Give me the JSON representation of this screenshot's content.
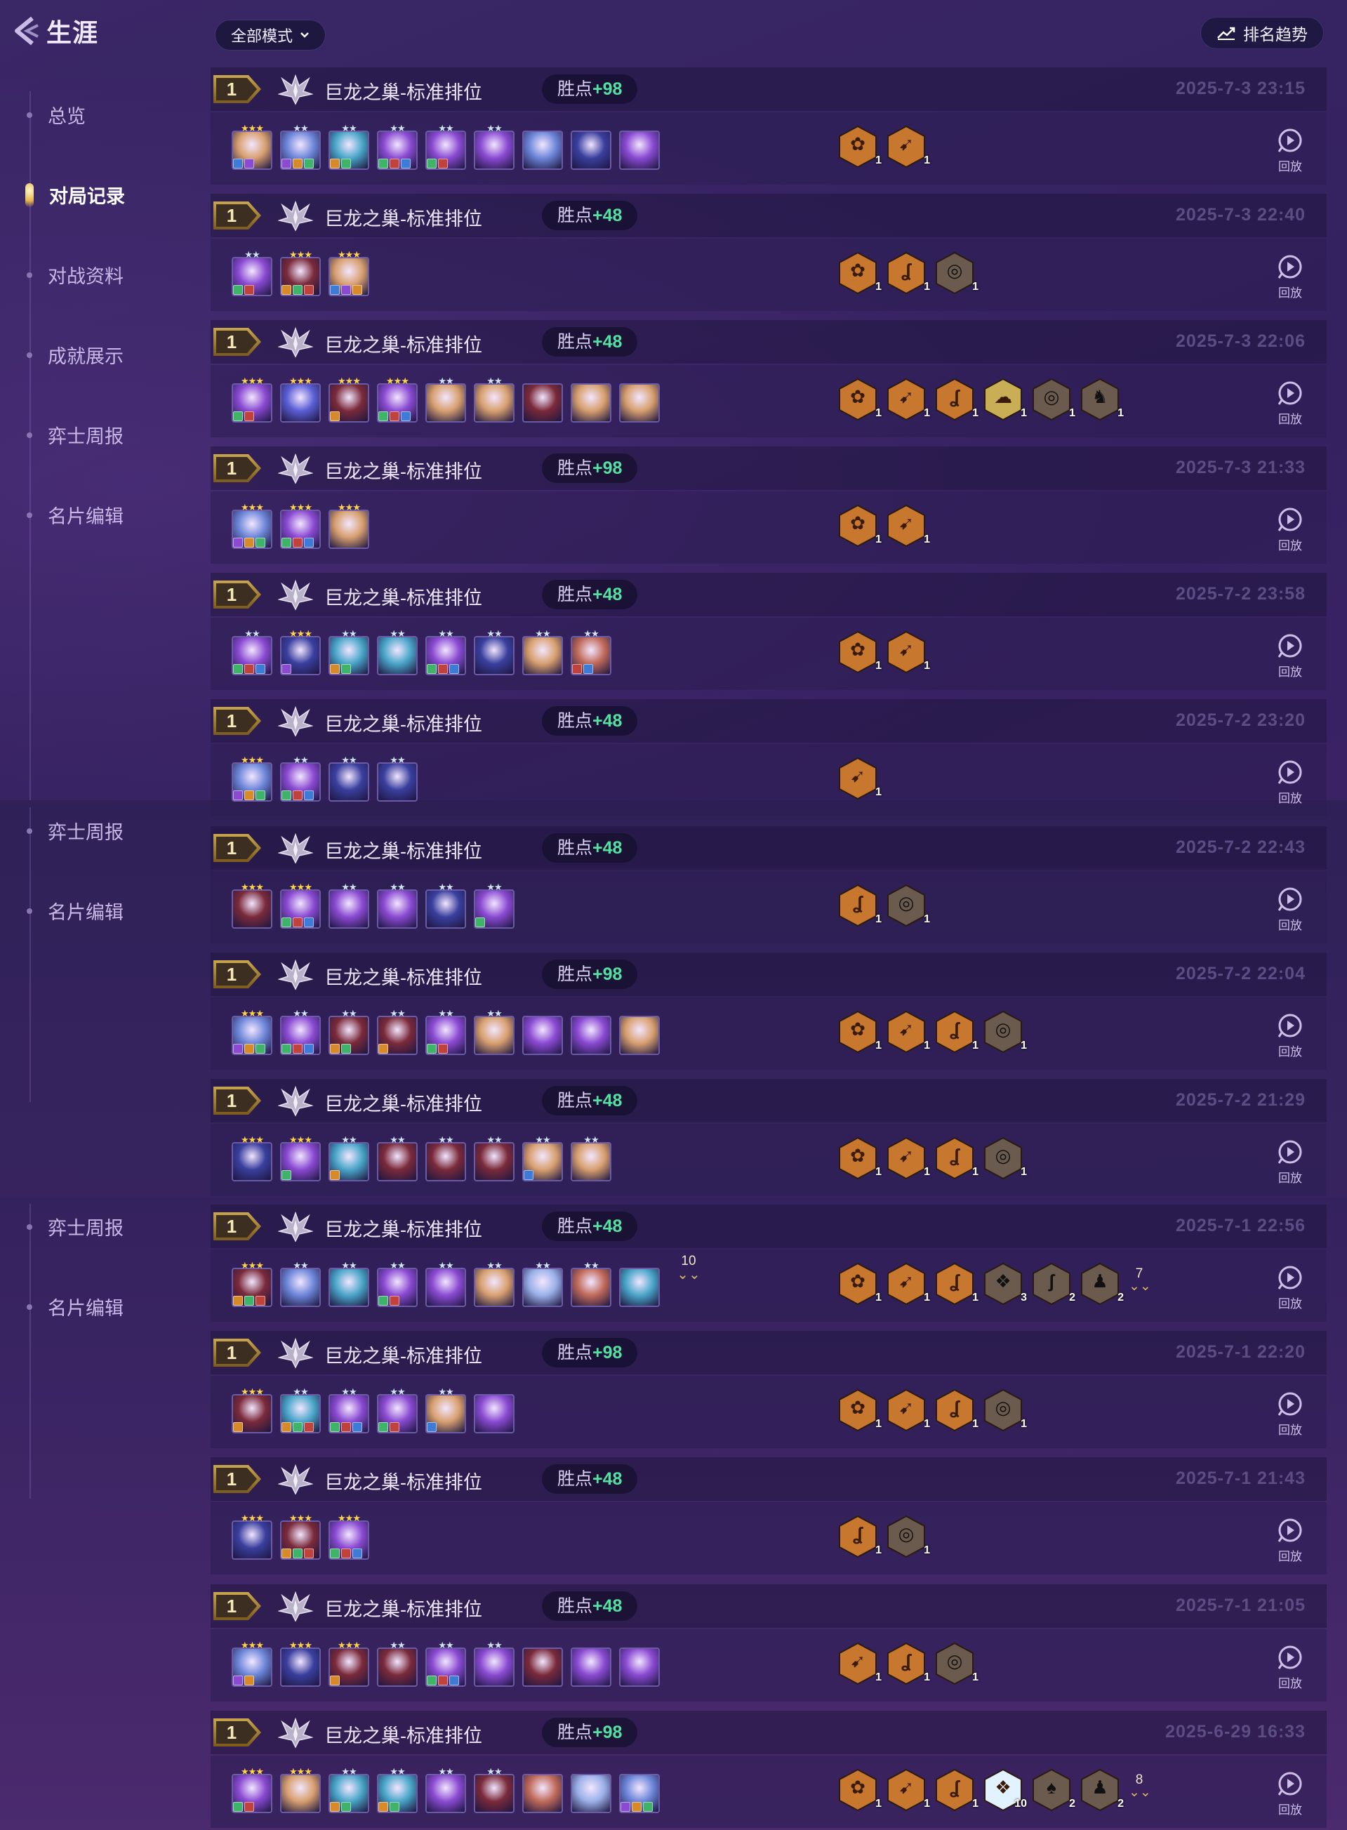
{
  "header": {
    "title": "生涯",
    "mode_label": "全部模式",
    "trend_label": "排名趋势"
  },
  "nav": {
    "items": [
      {
        "label": "总览",
        "active": false
      },
      {
        "label": "对局记录",
        "active": true
      },
      {
        "label": "对战资料",
        "active": false
      },
      {
        "label": "成就展示",
        "active": false
      },
      {
        "label": "弈士周报",
        "active": false
      },
      {
        "label": "名片编辑",
        "active": false
      }
    ],
    "repeat": [
      {
        "label": "弈士周报"
      },
      {
        "label": "名片编辑"
      },
      {
        "label": "弈士周报"
      },
      {
        "label": "名片编辑"
      }
    ]
  },
  "replay_label": "回放",
  "lp_prefix": "胜点",
  "colors": {
    "portrait_palette": [
      "#5b5fd6",
      "#6d86d9",
      "#4aa6c9",
      "#8a4ad2",
      "#c06a5a",
      "#d8a070",
      "#3a3f9e",
      "#7a2a3a",
      "#9ab0e8"
    ],
    "trait_bronze": "#c8782e",
    "trait_gold": "#c9ae55",
    "trait_gray": "#6b5a4e",
    "trait_prismatic": "#e3f2ff"
  },
  "matches": [
    {
      "rank": "1",
      "mode": "巨龙之巢-标准排位",
      "lp": "+98",
      "time": "2025-7-3 23:15",
      "units": [
        {
          "stars": 3,
          "c": 5,
          "items": 2
        },
        {
          "stars": 2,
          "c": 1,
          "items": 3
        },
        {
          "stars": 2,
          "c": 2,
          "items": 2
        },
        {
          "stars": 2,
          "c": 3,
          "items": 3
        },
        {
          "stars": 2,
          "c": 3,
          "items": 2
        },
        {
          "stars": 2,
          "c": 3,
          "items": 0
        },
        {
          "stars": 0,
          "c": 1,
          "items": 0
        },
        {
          "stars": 0,
          "c": 6,
          "items": 0
        },
        {
          "stars": 0,
          "c": 3,
          "items": 0
        }
      ],
      "more": "",
      "traits": [
        {
          "g": "✿",
          "n": "1",
          "t": "bronze"
        },
        {
          "g": "➹",
          "n": "1",
          "t": "bronze"
        }
      ],
      "traits_more": ""
    },
    {
      "rank": "1",
      "mode": "巨龙之巢-标准排位",
      "lp": "+48",
      "time": "2025-7-3 22:40",
      "units": [
        {
          "stars": 2,
          "c": 3,
          "items": 2
        },
        {
          "stars": 3,
          "c": 7,
          "items": 3
        },
        {
          "stars": 3,
          "c": 5,
          "items": 3
        }
      ],
      "more": "",
      "traits": [
        {
          "g": "✿",
          "n": "1",
          "t": "bronze"
        },
        {
          "g": "ʆ",
          "n": "1",
          "t": "bronze"
        },
        {
          "g": "◎",
          "n": "1",
          "t": "gray"
        }
      ],
      "traits_more": ""
    },
    {
      "rank": "1",
      "mode": "巨龙之巢-标准排位",
      "lp": "+48",
      "time": "2025-7-3 22:06",
      "units": [
        {
          "stars": 3,
          "c": 3,
          "items": 2
        },
        {
          "stars": 3,
          "c": 0,
          "items": 0
        },
        {
          "stars": 3,
          "c": 7,
          "items": 1
        },
        {
          "stars": 3,
          "c": 3,
          "items": 3
        },
        {
          "stars": 2,
          "c": 5,
          "items": 0
        },
        {
          "stars": 2,
          "c": 5,
          "items": 0
        },
        {
          "stars": 0,
          "c": 7,
          "items": 0
        },
        {
          "stars": 0,
          "c": 5,
          "items": 0
        },
        {
          "stars": 0,
          "c": 5,
          "items": 0
        }
      ],
      "more": "",
      "traits": [
        {
          "g": "✿",
          "n": "1",
          "t": "bronze"
        },
        {
          "g": "➹",
          "n": "1",
          "t": "bronze"
        },
        {
          "g": "ʆ",
          "n": "1",
          "t": "bronze"
        },
        {
          "g": "☁",
          "n": "1",
          "t": "gold"
        },
        {
          "g": "◎",
          "n": "1",
          "t": "gray"
        },
        {
          "g": "♞",
          "n": "1",
          "t": "gray"
        }
      ],
      "traits_more": ""
    },
    {
      "rank": "1",
      "mode": "巨龙之巢-标准排位",
      "lp": "+98",
      "time": "2025-7-3 21:33",
      "units": [
        {
          "stars": 3,
          "c": 1,
          "items": 3
        },
        {
          "stars": 3,
          "c": 3,
          "items": 3
        },
        {
          "stars": 3,
          "c": 5,
          "items": 0
        }
      ],
      "more": "",
      "traits": [
        {
          "g": "✿",
          "n": "1",
          "t": "bronze"
        },
        {
          "g": "➹",
          "n": "1",
          "t": "bronze"
        }
      ],
      "traits_more": ""
    },
    {
      "rank": "1",
      "mode": "巨龙之巢-标准排位",
      "lp": "+48",
      "time": "2025-7-2 23:58",
      "units": [
        {
          "stars": 2,
          "c": 3,
          "items": 3
        },
        {
          "stars": 3,
          "c": 6,
          "items": 1
        },
        {
          "stars": 2,
          "c": 2,
          "items": 2
        },
        {
          "stars": 2,
          "c": 2,
          "items": 0
        },
        {
          "stars": 2,
          "c": 3,
          "items": 3
        },
        {
          "stars": 2,
          "c": 6,
          "items": 0
        },
        {
          "stars": 2,
          "c": 5,
          "items": 0
        },
        {
          "stars": 2,
          "c": 4,
          "items": 2
        }
      ],
      "more": "",
      "traits": [
        {
          "g": "✿",
          "n": "1",
          "t": "bronze"
        },
        {
          "g": "➹",
          "n": "1",
          "t": "bronze"
        }
      ],
      "traits_more": ""
    },
    {
      "rank": "1",
      "mode": "巨龙之巢-标准排位",
      "lp": "+48",
      "time": "2025-7-2 23:20",
      "units": [
        {
          "stars": 3,
          "c": 1,
          "items": 3
        },
        {
          "stars": 2,
          "c": 3,
          "items": 3
        },
        {
          "stars": 2,
          "c": 6,
          "items": 0
        },
        {
          "stars": 2,
          "c": 6,
          "items": 0
        }
      ],
      "more": "",
      "traits": [
        {
          "g": "➹",
          "n": "1",
          "t": "bronze"
        }
      ],
      "traits_more": ""
    },
    {
      "rank": "1",
      "mode": "巨龙之巢-标准排位",
      "lp": "+48",
      "time": "2025-7-2 22:43",
      "units": [
        {
          "stars": 3,
          "c": 7,
          "items": 0
        },
        {
          "stars": 3,
          "c": 3,
          "items": 3
        },
        {
          "stars": 2,
          "c": 3,
          "items": 0
        },
        {
          "stars": 2,
          "c": 3,
          "items": 0
        },
        {
          "stars": 2,
          "c": 6,
          "items": 0
        },
        {
          "stars": 2,
          "c": 3,
          "items": 1
        }
      ],
      "more": "",
      "traits": [
        {
          "g": "ʆ",
          "n": "1",
          "t": "bronze"
        },
        {
          "g": "◎",
          "n": "1",
          "t": "gray"
        }
      ],
      "traits_more": ""
    },
    {
      "rank": "1",
      "mode": "巨龙之巢-标准排位",
      "lp": "+98",
      "time": "2025-7-2 22:04",
      "units": [
        {
          "stars": 3,
          "c": 1,
          "items": 3
        },
        {
          "stars": 2,
          "c": 3,
          "items": 3
        },
        {
          "stars": 2,
          "c": 7,
          "items": 2
        },
        {
          "stars": 2,
          "c": 7,
          "items": 1
        },
        {
          "stars": 2,
          "c": 3,
          "items": 2
        },
        {
          "stars": 2,
          "c": 5,
          "items": 0
        },
        {
          "stars": 0,
          "c": 3,
          "items": 0
        },
        {
          "stars": 0,
          "c": 3,
          "items": 0
        },
        {
          "stars": 0,
          "c": 5,
          "items": 0
        }
      ],
      "more": "",
      "traits": [
        {
          "g": "✿",
          "n": "1",
          "t": "bronze"
        },
        {
          "g": "➹",
          "n": "1",
          "t": "bronze"
        },
        {
          "g": "ʆ",
          "n": "1",
          "t": "bronze"
        },
        {
          "g": "◎",
          "n": "1",
          "t": "gray"
        }
      ],
      "traits_more": ""
    },
    {
      "rank": "1",
      "mode": "巨龙之巢-标准排位",
      "lp": "+48",
      "time": "2025-7-2 21:29",
      "units": [
        {
          "stars": 3,
          "c": 6,
          "items": 0
        },
        {
          "stars": 3,
          "c": 3,
          "items": 1
        },
        {
          "stars": 2,
          "c": 2,
          "items": 1
        },
        {
          "stars": 2,
          "c": 7,
          "items": 0
        },
        {
          "stars": 2,
          "c": 7,
          "items": 0
        },
        {
          "stars": 2,
          "c": 7,
          "items": 0
        },
        {
          "stars": 2,
          "c": 5,
          "items": 1
        },
        {
          "stars": 2,
          "c": 5,
          "items": 0
        }
      ],
      "more": "",
      "traits": [
        {
          "g": "✿",
          "n": "1",
          "t": "bronze"
        },
        {
          "g": "➹",
          "n": "1",
          "t": "bronze"
        },
        {
          "g": "ʆ",
          "n": "1",
          "t": "bronze"
        },
        {
          "g": "◎",
          "n": "1",
          "t": "gray"
        }
      ],
      "traits_more": ""
    },
    {
      "rank": "1",
      "mode": "巨龙之巢-标准排位",
      "lp": "+48",
      "time": "2025-7-1 22:56",
      "units": [
        {
          "stars": 3,
          "c": 7,
          "items": 3
        },
        {
          "stars": 2,
          "c": 1,
          "items": 0
        },
        {
          "stars": 2,
          "c": 2,
          "items": 0
        },
        {
          "stars": 2,
          "c": 3,
          "items": 2
        },
        {
          "stars": 2,
          "c": 3,
          "items": 0
        },
        {
          "stars": 2,
          "c": 5,
          "items": 0
        },
        {
          "stars": 2,
          "c": 8,
          "items": 0
        },
        {
          "stars": 2,
          "c": 4,
          "items": 0
        },
        {
          "stars": 0,
          "c": 2,
          "items": 0
        }
      ],
      "more": "10",
      "traits": [
        {
          "g": "✿",
          "n": "1",
          "t": "bronze"
        },
        {
          "g": "➹",
          "n": "1",
          "t": "bronze"
        },
        {
          "g": "ʆ",
          "n": "1",
          "t": "bronze"
        },
        {
          "g": "❖",
          "n": "3",
          "t": "gray"
        },
        {
          "g": "ʃ",
          "n": "2",
          "t": "gray"
        },
        {
          "g": "♟",
          "n": "2",
          "t": "gray"
        }
      ],
      "traits_more": "7"
    },
    {
      "rank": "1",
      "mode": "巨龙之巢-标准排位",
      "lp": "+98",
      "time": "2025-7-1 22:20",
      "units": [
        {
          "stars": 3,
          "c": 7,
          "items": 1
        },
        {
          "stars": 2,
          "c": 2,
          "items": 3
        },
        {
          "stars": 2,
          "c": 3,
          "items": 3
        },
        {
          "stars": 2,
          "c": 3,
          "items": 2
        },
        {
          "stars": 2,
          "c": 5,
          "items": 1
        },
        {
          "stars": 0,
          "c": 3,
          "items": 0
        }
      ],
      "more": "",
      "traits": [
        {
          "g": "✿",
          "n": "1",
          "t": "bronze"
        },
        {
          "g": "➹",
          "n": "1",
          "t": "bronze"
        },
        {
          "g": "ʆ",
          "n": "1",
          "t": "bronze"
        },
        {
          "g": "◎",
          "n": "1",
          "t": "gray"
        }
      ],
      "traits_more": ""
    },
    {
      "rank": "1",
      "mode": "巨龙之巢-标准排位",
      "lp": "+48",
      "time": "2025-7-1 21:43",
      "units": [
        {
          "stars": 3,
          "c": 6,
          "items": 0
        },
        {
          "stars": 3,
          "c": 7,
          "items": 3
        },
        {
          "stars": 3,
          "c": 3,
          "items": 3
        }
      ],
      "more": "",
      "traits": [
        {
          "g": "ʆ",
          "n": "1",
          "t": "bronze"
        },
        {
          "g": "◎",
          "n": "1",
          "t": "gray"
        }
      ],
      "traits_more": ""
    },
    {
      "rank": "1",
      "mode": "巨龙之巢-标准排位",
      "lp": "+48",
      "time": "2025-7-1 21:05",
      "units": [
        {
          "stars": 3,
          "c": 1,
          "items": 2
        },
        {
          "stars": 3,
          "c": 6,
          "items": 0
        },
        {
          "stars": 3,
          "c": 7,
          "items": 1
        },
        {
          "stars": 2,
          "c": 7,
          "items": 0
        },
        {
          "stars": 2,
          "c": 3,
          "items": 3
        },
        {
          "stars": 2,
          "c": 3,
          "items": 0
        },
        {
          "stars": 0,
          "c": 7,
          "items": 0
        },
        {
          "stars": 0,
          "c": 3,
          "items": 0
        },
        {
          "stars": 0,
          "c": 3,
          "items": 0
        }
      ],
      "more": "",
      "traits": [
        {
          "g": "➹",
          "n": "1",
          "t": "bronze"
        },
        {
          "g": "ʆ",
          "n": "1",
          "t": "bronze"
        },
        {
          "g": "◎",
          "n": "1",
          "t": "gray"
        }
      ],
      "traits_more": ""
    },
    {
      "rank": "1",
      "mode": "巨龙之巢-标准排位",
      "lp": "+98",
      "time": "2025-6-29 16:33",
      "units": [
        {
          "stars": 3,
          "c": 3,
          "items": 2
        },
        {
          "stars": 3,
          "c": 5,
          "items": 0
        },
        {
          "stars": 2,
          "c": 2,
          "items": 2
        },
        {
          "stars": 2,
          "c": 2,
          "items": 2
        },
        {
          "stars": 2,
          "c": 3,
          "items": 0
        },
        {
          "stars": 2,
          "c": 7,
          "items": 0
        },
        {
          "stars": 0,
          "c": 4,
          "items": 0
        },
        {
          "stars": 0,
          "c": 8,
          "items": 0
        },
        {
          "stars": 0,
          "c": 1,
          "items": 3
        }
      ],
      "more": "",
      "traits": [
        {
          "g": "✿",
          "n": "1",
          "t": "bronze"
        },
        {
          "g": "➹",
          "n": "1",
          "t": "bronze"
        },
        {
          "g": "ʆ",
          "n": "1",
          "t": "bronze"
        },
        {
          "g": "❖",
          "n": "10",
          "t": "prismatic"
        },
        {
          "g": "♠",
          "n": "2",
          "t": "gray"
        },
        {
          "g": "♟",
          "n": "2",
          "t": "gray"
        }
      ],
      "traits_more": "8"
    }
  ]
}
